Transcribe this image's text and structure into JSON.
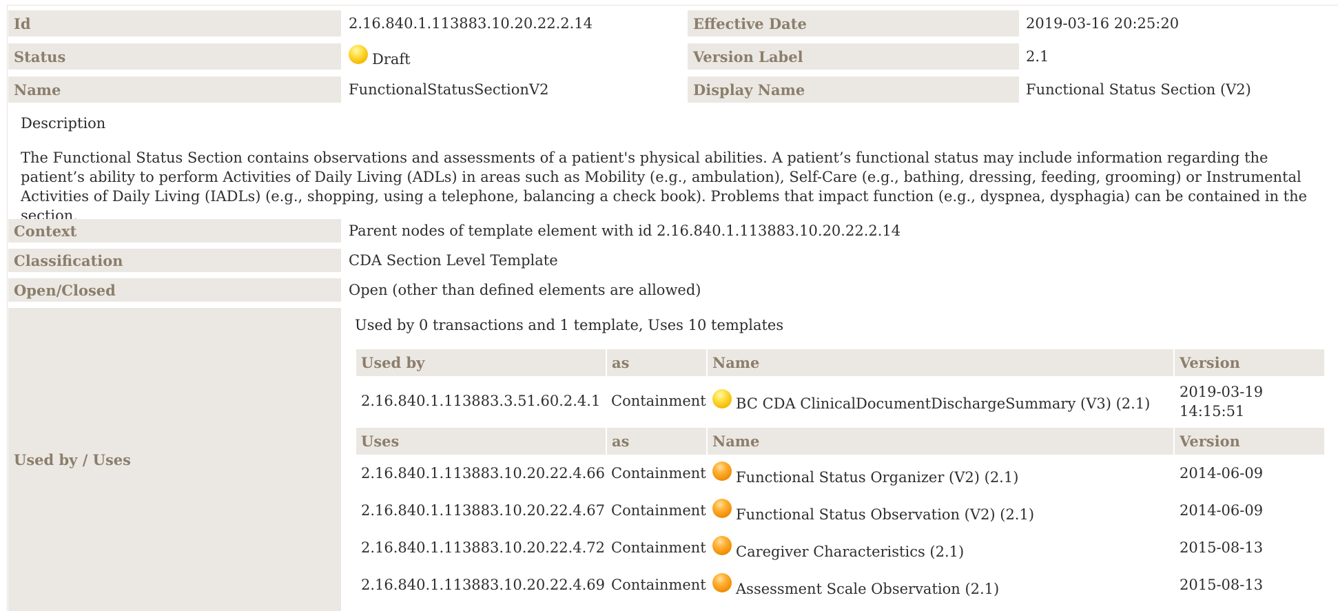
{
  "top": {
    "id_label": "Id",
    "id_value": "2.16.840.1.113883.10.20.22.2.14",
    "effective_label": "Effective Date",
    "effective_value": "2019-03-16 20:25:20",
    "status_label": "Status",
    "status_value": "Draft",
    "status_color": "#f5b800",
    "version_label_label": "Version Label",
    "version_label_value": "2.1",
    "name_label": "Name",
    "name_value": "FunctionalStatusSectionV2",
    "display_label": "Display Name",
    "display_value": "Functional Status Section (V2)"
  },
  "description": {
    "title": "Description",
    "text": "The Functional Status Section contains observations and assessments of a patient's physical abilities. A patient’s functional status may include information regarding the patient’s ability to perform Activities of Daily Living (ADLs) in areas such as Mobility (e.g., ambulation), Self-Care (e.g., bathing, dressing, feeding, grooming) or Instrumental Activities of Daily Living (IADLs) (e.g., shopping, using a telephone, balancing a check book). Problems that impact function (e.g., dyspnea, dysphagia) can be contained in the section."
  },
  "meta": {
    "context_label": "Context",
    "context_value": "Parent nodes of template element with id 2.16.840.1.113883.10.20.22.2.14",
    "classification_label": "Classification",
    "classification_value": "CDA Section Level Template",
    "open_label": "Open/Closed",
    "open_value": "Open (other than defined elements are allowed)",
    "usedby_label": "Used by / Uses"
  },
  "usage": {
    "summary": "Used by 0 transactions and 1 template, Uses 10 templates",
    "used_by_header": {
      "id": "Used by",
      "as": "as",
      "name": "Name",
      "version": "Version"
    },
    "used_by": [
      {
        "id": "2.16.840.1.113883.3.51.60.2.4.1",
        "as": "Containment",
        "name": "BC CDA ClinicalDocumentDischargeSummary (V3) (2.1)",
        "version": "2019-03-19 14:15:51",
        "icon": "yellow-status-dot-icon"
      }
    ],
    "uses_header": {
      "id": "Uses",
      "as": "as",
      "name": "Name",
      "version": "Version"
    },
    "uses": [
      {
        "id": "2.16.840.1.113883.10.20.22.4.66",
        "as": "Containment",
        "name": "Functional Status Organizer (V2) (2.1)",
        "version": "2014-06-09",
        "icon": "orange-status-dot-icon"
      },
      {
        "id": "2.16.840.1.113883.10.20.22.4.67",
        "as": "Containment",
        "name": "Functional Status Observation (V2) (2.1)",
        "version": "2014-06-09",
        "icon": "orange-status-dot-icon"
      },
      {
        "id": "2.16.840.1.113883.10.20.22.4.72",
        "as": "Containment",
        "name": "Caregiver Characteristics (2.1)",
        "version": "2015-08-13",
        "icon": "orange-status-dot-icon"
      },
      {
        "id": "2.16.840.1.113883.10.20.22.4.69",
        "as": "Containment",
        "name": "Assessment Scale Observation (2.1)",
        "version": "2015-08-13",
        "icon": "orange-status-dot-icon"
      }
    ]
  }
}
